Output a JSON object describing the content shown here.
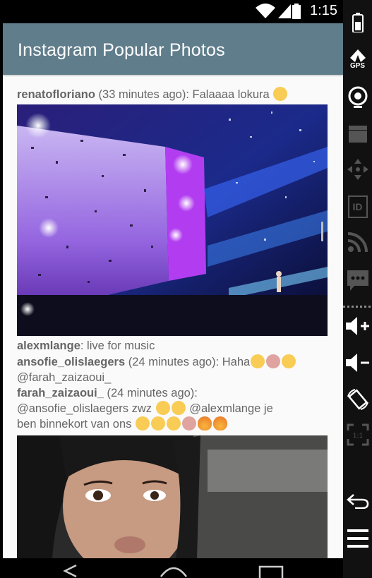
{
  "status_bar": {
    "time": "1:15"
  },
  "app": {
    "title": "Instagram Popular Photos"
  },
  "feed": {
    "post1": {
      "username": "renatofloriano",
      "time": "(33 minutes ago)",
      "caption": "Falaaaa lokura"
    },
    "post2": {
      "username": "alexmlange",
      "caption": ": live for music",
      "comments": [
        {
          "user": "ansofie_olislaegers",
          "time": "(24 minutes ago)",
          "text": ": Haha",
          "mention": "@farah_zaizaoui_"
        },
        {
          "user": "farah_zaizaoui_",
          "time": "(24 minutes ago):",
          "text": "@ansofie_olislaegers zwz",
          "mention": "@alexmlange je",
          "text2": "ben binnekort van ons"
        }
      ]
    }
  },
  "toolbar": {
    "gps_label": "GPS",
    "id_label": "ID"
  },
  "colors": {
    "actionbar": "#607d8b",
    "background": "#fafafa"
  }
}
